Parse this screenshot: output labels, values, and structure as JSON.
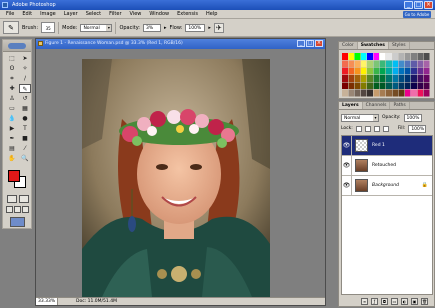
{
  "app": {
    "title": "Adobe Photoshop"
  },
  "window_buttons": [
    "_",
    "□",
    "×"
  ],
  "menubar": {
    "items": [
      "File",
      "Edit",
      "Image",
      "Layer",
      "Select",
      "Filter",
      "View",
      "Window",
      "Extensis",
      "Help"
    ],
    "go_button": "Go to Adobe"
  },
  "options": {
    "brush_label": "Brush:",
    "brush_size": "35",
    "mode_label": "Mode:",
    "mode_value": "Normal",
    "opacity_label": "Opacity:",
    "opacity_value": "3%",
    "flow_label": "Flow:",
    "flow_value": "100%"
  },
  "document": {
    "title": "Figure 1 - Renaissance Woman.psd @ 33.3% (Red 1, RGB/16)",
    "zoom": "33.33%",
    "doc_info": "Doc: 11.0M/51.4M"
  },
  "swatches_panel": {
    "tabs": [
      "Color",
      "Swatches",
      "Styles"
    ],
    "active_tab": "Swatches",
    "colors": [
      "#ff0000",
      "#ffff00",
      "#00ff00",
      "#00ffff",
      "#0000ff",
      "#ff00ff",
      "#ffffff",
      "#e6e6e6",
      "#cccccc",
      "#b3b3b3",
      "#999999",
      "#808080",
      "#666666",
      "#4d4d4d",
      "#f26c4f",
      "#f68e55",
      "#fbaf5c",
      "#fff467",
      "#acd372",
      "#7cc576",
      "#3bb878",
      "#1abbb4",
      "#00bff3",
      "#438cca",
      "#5574b9",
      "#605ca8",
      "#855fa8",
      "#a763a8",
      "#ed1c24",
      "#f26522",
      "#f7941d",
      "#fff200",
      "#8dc63f",
      "#39b54a",
      "#00a651",
      "#00a99d",
      "#00aeef",
      "#0072bc",
      "#0054a6",
      "#2e3192",
      "#662d91",
      "#92278f",
      "#9e0b0f",
      "#a0410d",
      "#a3620a",
      "#aba000",
      "#598527",
      "#1a7b30",
      "#007236",
      "#00746b",
      "#0076a3",
      "#004b80",
      "#003471",
      "#1b1464",
      "#440e62",
      "#630460",
      "#790000",
      "#7b2e00",
      "#7d4900",
      "#827b00",
      "#406618",
      "#005e20",
      "#005826",
      "#005952",
      "#005b7f",
      "#003663",
      "#002157",
      "#0d004c",
      "#32004b",
      "#4b0049",
      "#c7b299",
      "#998675",
      "#736357",
      "#534741",
      "#37302d",
      "#c69c6d",
      "#a67c52",
      "#8c6239",
      "#754c24",
      "#603913",
      "#ec008c",
      "#f06eaa",
      "#ee105a",
      "#9e005d"
    ]
  },
  "layers_panel": {
    "tabs": [
      "Layers",
      "Channels",
      "Paths"
    ],
    "active_tab": "Layers",
    "blend_mode": "Normal",
    "opacity_label": "Opacity:",
    "opacity_value": "100%",
    "lock_label": "Lock:",
    "fill_label": "Fill:",
    "fill_value": "100%",
    "layers": [
      {
        "name": "Red 1",
        "selected": true
      },
      {
        "name": "Retouched",
        "selected": false
      },
      {
        "name": "Background",
        "selected": false
      }
    ]
  }
}
